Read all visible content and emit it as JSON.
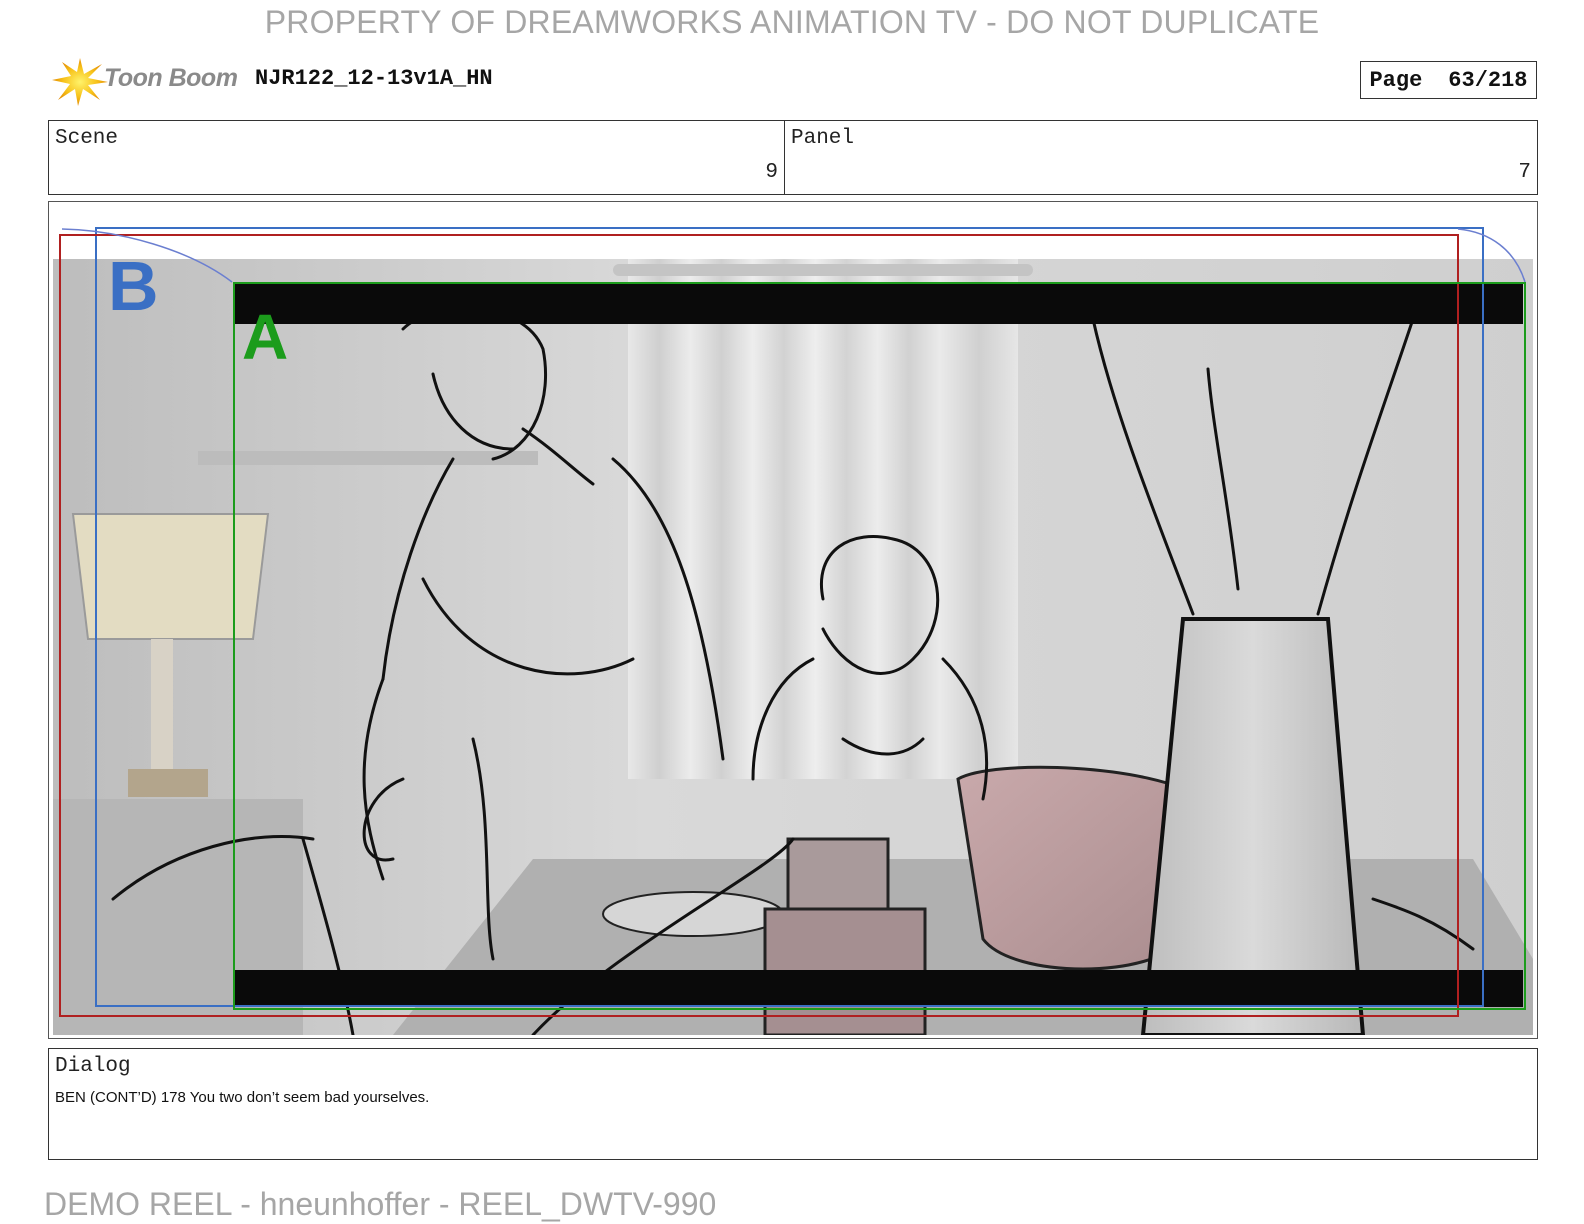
{
  "watermark_top": "PROPERTY OF DREAMWORKS ANIMATION TV - DO NOT DUPLICATE",
  "logo": {
    "text": "Toon Boom",
    "icon": "starburst-logo-icon"
  },
  "file_id": "NJR122_12-13v1A_HN",
  "page": {
    "label": "Page",
    "value": "63/218"
  },
  "scene": {
    "label": "Scene",
    "value": "9"
  },
  "panel": {
    "label": "Panel",
    "value": "7"
  },
  "frames": {
    "outer_label": "B",
    "inner_label": "A",
    "outer_color": "#3a6fc4",
    "inner_color": "#1c9c1c",
    "safe_color": "#b02020"
  },
  "dialog": {
    "label": "Dialog",
    "text": "BEN (CONT’D) 178 You two don’t seem bad yourselves."
  },
  "watermark_bottom": "DEMO REEL - hneunhoffer - REEL_DWTV-990"
}
